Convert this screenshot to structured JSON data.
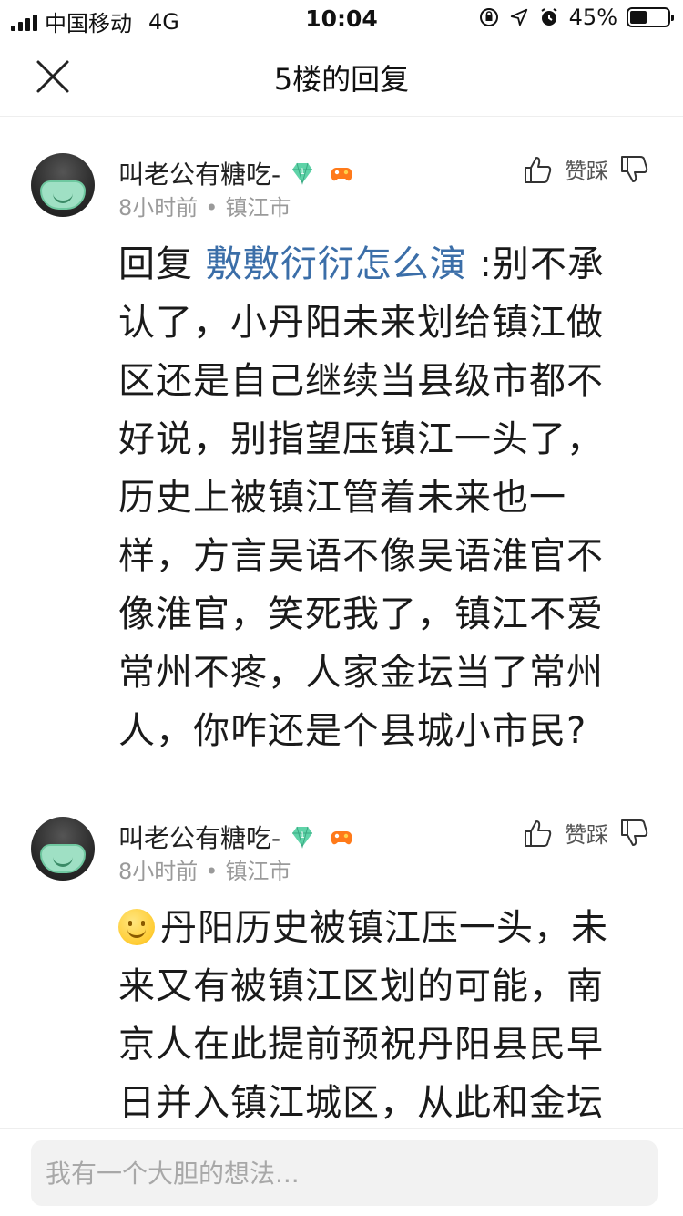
{
  "status_bar": {
    "carrier": "中国移动",
    "network": "4G",
    "time": "10:04",
    "battery_text": "45%",
    "battery_level": 0.45
  },
  "header": {
    "title": "5楼的回复",
    "close_icon": "close-icon"
  },
  "comments": [
    {
      "username": "叫老公有糖吃-",
      "level_badge": "1",
      "time_ago": "8小时前",
      "separator": "•",
      "location": "镇江市",
      "vote_label": "赞踩",
      "reply_prefix": "回复 ",
      "mention": "敷敷衍衍怎么演",
      "body": " :别不承认了，小丹阳未来划给镇江做区还是自己继续当县级市都不好说，别指望压镇江一头了，历史上被镇江管着未来也一样，方言吴语不像吴语淮官不像淮官，笑死我了，镇江不爱常州不疼，人家金坛当了常州人，你咋还是个县城小市民?"
    },
    {
      "username": "叫老公有糖吃-",
      "level_badge": "1",
      "time_ago": "8小时前",
      "separator": "•",
      "location": "镇江市",
      "vote_label": "赞踩",
      "emoji": "smile-emoji",
      "body": "丹阳历史被镇江压一头，未来又有被镇江区划的可能，南京人在此提前预祝丹阳县民早日并入镇江城区，从此和金坛"
    }
  ],
  "reply_input": {
    "placeholder": "我有一个大胆的想法..."
  },
  "colors": {
    "mention": "#3b6ea8",
    "meta": "#9a9a9a",
    "diamond_badge": "#5fd3a8",
    "game_badge": "#ff7a1a"
  }
}
